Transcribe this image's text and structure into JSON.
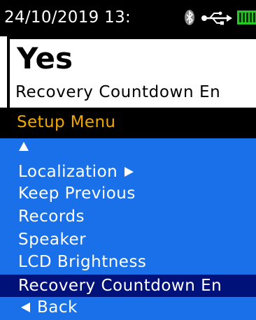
{
  "status_bar": {
    "datetime": "24/10/2019 13:",
    "icons": [
      "bluetooth-icon",
      "usb-icon",
      "battery-icon"
    ],
    "battery_color": "#22cc22"
  },
  "value_panel": {
    "value": "Yes",
    "parameter": "Recovery Countdown En"
  },
  "menu": {
    "title": "Setup Menu",
    "title_color": "#f0a800",
    "background_color": "#1a70e8",
    "selected_color": "#00127a",
    "scroll_up_icon": "up-arrow-icon",
    "items": [
      {
        "label": "Localization",
        "icon": "right-arrow-icon"
      },
      {
        "label": "Keep Previous"
      },
      {
        "label": "Records"
      },
      {
        "label": "Speaker"
      },
      {
        "label": "LCD Brightness"
      },
      {
        "label": "Recovery Countdown En",
        "selected": true
      }
    ],
    "back_label": "Back",
    "back_icon": "left-arrow-icon"
  }
}
